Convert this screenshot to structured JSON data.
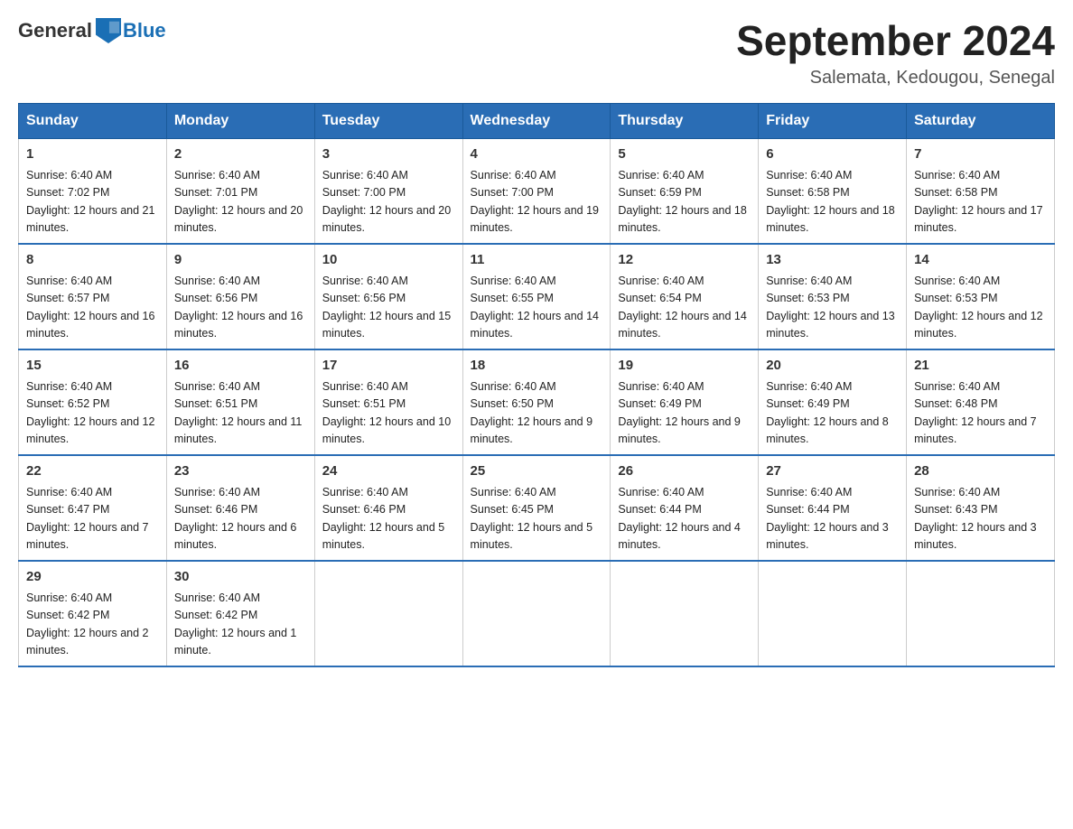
{
  "header": {
    "logo_general": "General",
    "logo_blue": "Blue",
    "month_year": "September 2024",
    "location": "Salemata, Kedougou, Senegal"
  },
  "weekdays": [
    "Sunday",
    "Monday",
    "Tuesday",
    "Wednesday",
    "Thursday",
    "Friday",
    "Saturday"
  ],
  "weeks": [
    [
      {
        "day": "1",
        "sunrise": "Sunrise: 6:40 AM",
        "sunset": "Sunset: 7:02 PM",
        "daylight": "Daylight: 12 hours and 21 minutes."
      },
      {
        "day": "2",
        "sunrise": "Sunrise: 6:40 AM",
        "sunset": "Sunset: 7:01 PM",
        "daylight": "Daylight: 12 hours and 20 minutes."
      },
      {
        "day": "3",
        "sunrise": "Sunrise: 6:40 AM",
        "sunset": "Sunset: 7:00 PM",
        "daylight": "Daylight: 12 hours and 20 minutes."
      },
      {
        "day": "4",
        "sunrise": "Sunrise: 6:40 AM",
        "sunset": "Sunset: 7:00 PM",
        "daylight": "Daylight: 12 hours and 19 minutes."
      },
      {
        "day": "5",
        "sunrise": "Sunrise: 6:40 AM",
        "sunset": "Sunset: 6:59 PM",
        "daylight": "Daylight: 12 hours and 18 minutes."
      },
      {
        "day": "6",
        "sunrise": "Sunrise: 6:40 AM",
        "sunset": "Sunset: 6:58 PM",
        "daylight": "Daylight: 12 hours and 18 minutes."
      },
      {
        "day": "7",
        "sunrise": "Sunrise: 6:40 AM",
        "sunset": "Sunset: 6:58 PM",
        "daylight": "Daylight: 12 hours and 17 minutes."
      }
    ],
    [
      {
        "day": "8",
        "sunrise": "Sunrise: 6:40 AM",
        "sunset": "Sunset: 6:57 PM",
        "daylight": "Daylight: 12 hours and 16 minutes."
      },
      {
        "day": "9",
        "sunrise": "Sunrise: 6:40 AM",
        "sunset": "Sunset: 6:56 PM",
        "daylight": "Daylight: 12 hours and 16 minutes."
      },
      {
        "day": "10",
        "sunrise": "Sunrise: 6:40 AM",
        "sunset": "Sunset: 6:56 PM",
        "daylight": "Daylight: 12 hours and 15 minutes."
      },
      {
        "day": "11",
        "sunrise": "Sunrise: 6:40 AM",
        "sunset": "Sunset: 6:55 PM",
        "daylight": "Daylight: 12 hours and 14 minutes."
      },
      {
        "day": "12",
        "sunrise": "Sunrise: 6:40 AM",
        "sunset": "Sunset: 6:54 PM",
        "daylight": "Daylight: 12 hours and 14 minutes."
      },
      {
        "day": "13",
        "sunrise": "Sunrise: 6:40 AM",
        "sunset": "Sunset: 6:53 PM",
        "daylight": "Daylight: 12 hours and 13 minutes."
      },
      {
        "day": "14",
        "sunrise": "Sunrise: 6:40 AM",
        "sunset": "Sunset: 6:53 PM",
        "daylight": "Daylight: 12 hours and 12 minutes."
      }
    ],
    [
      {
        "day": "15",
        "sunrise": "Sunrise: 6:40 AM",
        "sunset": "Sunset: 6:52 PM",
        "daylight": "Daylight: 12 hours and 12 minutes."
      },
      {
        "day": "16",
        "sunrise": "Sunrise: 6:40 AM",
        "sunset": "Sunset: 6:51 PM",
        "daylight": "Daylight: 12 hours and 11 minutes."
      },
      {
        "day": "17",
        "sunrise": "Sunrise: 6:40 AM",
        "sunset": "Sunset: 6:51 PM",
        "daylight": "Daylight: 12 hours and 10 minutes."
      },
      {
        "day": "18",
        "sunrise": "Sunrise: 6:40 AM",
        "sunset": "Sunset: 6:50 PM",
        "daylight": "Daylight: 12 hours and 9 minutes."
      },
      {
        "day": "19",
        "sunrise": "Sunrise: 6:40 AM",
        "sunset": "Sunset: 6:49 PM",
        "daylight": "Daylight: 12 hours and 9 minutes."
      },
      {
        "day": "20",
        "sunrise": "Sunrise: 6:40 AM",
        "sunset": "Sunset: 6:49 PM",
        "daylight": "Daylight: 12 hours and 8 minutes."
      },
      {
        "day": "21",
        "sunrise": "Sunrise: 6:40 AM",
        "sunset": "Sunset: 6:48 PM",
        "daylight": "Daylight: 12 hours and 7 minutes."
      }
    ],
    [
      {
        "day": "22",
        "sunrise": "Sunrise: 6:40 AM",
        "sunset": "Sunset: 6:47 PM",
        "daylight": "Daylight: 12 hours and 7 minutes."
      },
      {
        "day": "23",
        "sunrise": "Sunrise: 6:40 AM",
        "sunset": "Sunset: 6:46 PM",
        "daylight": "Daylight: 12 hours and 6 minutes."
      },
      {
        "day": "24",
        "sunrise": "Sunrise: 6:40 AM",
        "sunset": "Sunset: 6:46 PM",
        "daylight": "Daylight: 12 hours and 5 minutes."
      },
      {
        "day": "25",
        "sunrise": "Sunrise: 6:40 AM",
        "sunset": "Sunset: 6:45 PM",
        "daylight": "Daylight: 12 hours and 5 minutes."
      },
      {
        "day": "26",
        "sunrise": "Sunrise: 6:40 AM",
        "sunset": "Sunset: 6:44 PM",
        "daylight": "Daylight: 12 hours and 4 minutes."
      },
      {
        "day": "27",
        "sunrise": "Sunrise: 6:40 AM",
        "sunset": "Sunset: 6:44 PM",
        "daylight": "Daylight: 12 hours and 3 minutes."
      },
      {
        "day": "28",
        "sunrise": "Sunrise: 6:40 AM",
        "sunset": "Sunset: 6:43 PM",
        "daylight": "Daylight: 12 hours and 3 minutes."
      }
    ],
    [
      {
        "day": "29",
        "sunrise": "Sunrise: 6:40 AM",
        "sunset": "Sunset: 6:42 PM",
        "daylight": "Daylight: 12 hours and 2 minutes."
      },
      {
        "day": "30",
        "sunrise": "Sunrise: 6:40 AM",
        "sunset": "Sunset: 6:42 PM",
        "daylight": "Daylight: 12 hours and 1 minute."
      },
      null,
      null,
      null,
      null,
      null
    ]
  ]
}
